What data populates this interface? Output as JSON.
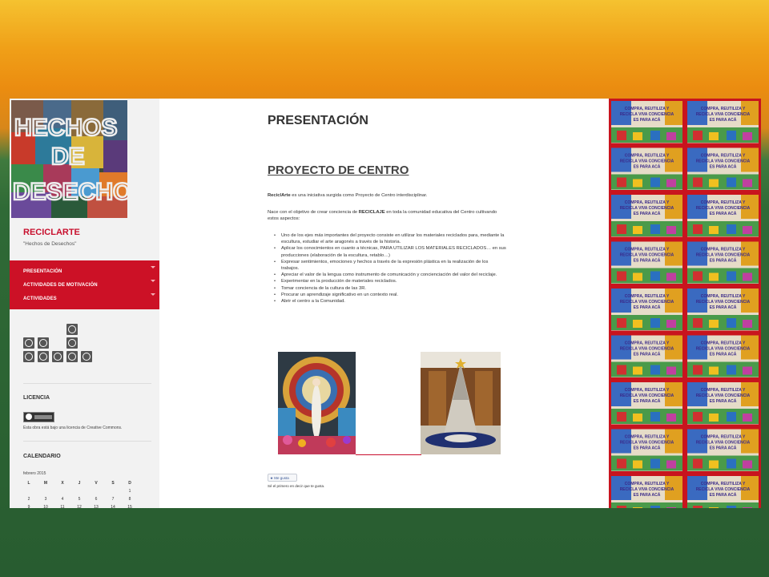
{
  "sidebar": {
    "logo_text": [
      "HECHOS",
      "DE",
      "DESECHOS"
    ],
    "site_title": "RECICLARTE",
    "tagline": "\"Hechos de Desechos\"",
    "menu": [
      {
        "label": "PRESENTACIÓN"
      },
      {
        "label": "ACTIVIDADES DE MOTIVACIÓN"
      },
      {
        "label": "ACTIVIDADES"
      }
    ],
    "license_title": "LICENCIA",
    "license_text": "Esta obra está bajo una licencia de Creative Commons.",
    "calendar_title": "CALENDARIO",
    "calendar_month": "febrero 2015",
    "calendar_days": [
      "L",
      "M",
      "X",
      "J",
      "V",
      "S",
      "D"
    ],
    "calendar_rows": [
      [
        "",
        "",
        "",
        "",
        "",
        "",
        "1"
      ],
      [
        "2",
        "3",
        "4",
        "5",
        "6",
        "7",
        "8"
      ],
      [
        "9",
        "10",
        "11",
        "12",
        "13",
        "14",
        "15"
      ]
    ]
  },
  "main": {
    "page_title": "PRESENTACIÓN",
    "section_title": "PROYECTO DE CENTRO",
    "intro_brand": "ReciclArte",
    "intro_rest": " es una iniciativa surgida como Proyecto de Centro interdisciplinar.",
    "goal_prefix": "Nace con el objetivo de crear conciencia de ",
    "goal_bold": "RECICLAJE",
    "goal_suffix": "  en toda la comunidad educativa del Centro cultivando estos aspectos:",
    "aims": [
      "Uno de los ejes más importantes del proyecto consiste en utilizar los materiales reciclados para, mediante la escultura, estudiar el arte aragonés a través de la historia.",
      "Aplicar los conocimientos en cuanto a técnicas, PARA UTILIZAR LOS MATERIALES RECICLADOS… en sus producciones (elaboración de la escultura, retablo…)",
      "Expresar sentimientos, emociones y hechos a través de la expresión plástica en la realización de los trabajos.",
      "Apreciar el valor de la lengua como instrumento de comunicación y concienciación del valor del reciclaje.",
      "Experimentar en la producción de materiales reciclados.",
      "Tomar conciencia de la cultura de las 3R.",
      "Procurar un aprendizaje significativo en un contexto real.",
      "Abrir el centro a la Comunidad."
    ],
    "like_label": "Me gusta",
    "like_text": "Sé el primero en decir que te gusta."
  },
  "poster_text": "COMPRA, REUTILIZA Y RECICLA VIVA CONCIENCIA ES PARA ACÁ"
}
